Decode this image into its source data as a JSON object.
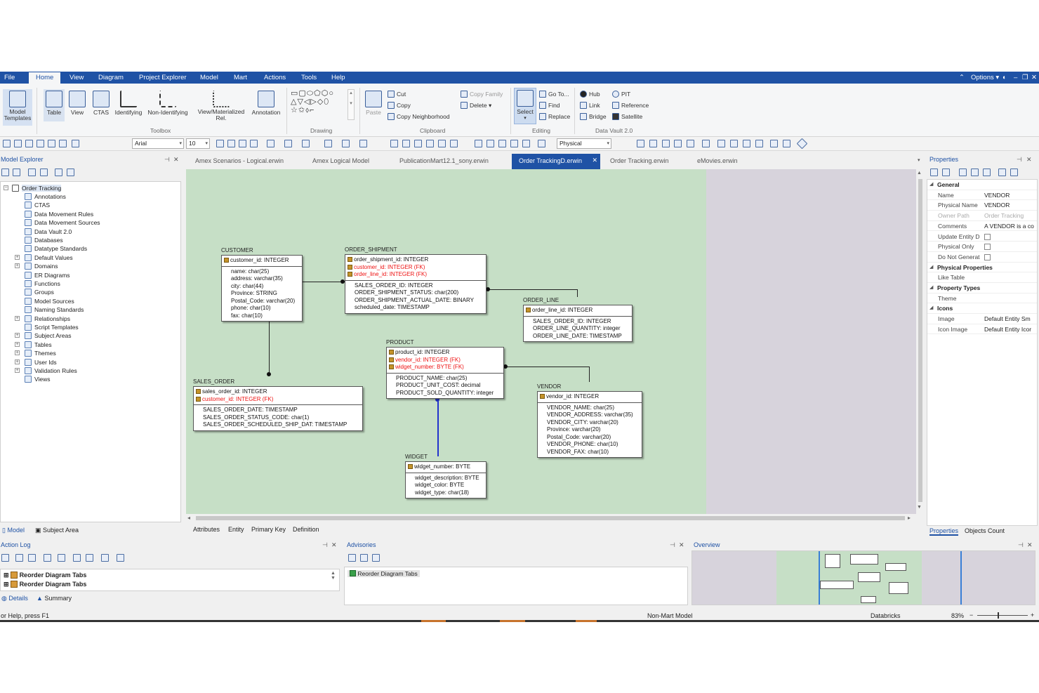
{
  "menu": {
    "items": [
      "File",
      "Home",
      "View",
      "Diagram",
      "Project Explorer",
      "Model",
      "Mart",
      "Actions",
      "Tools",
      "Help"
    ],
    "options": "Options"
  },
  "ribbon": {
    "model_templates": "Model Templates",
    "table": "Table",
    "view": "View",
    "ctas": "CTAS",
    "identifying": "Identifying",
    "non_identifying": "Non-Identifying",
    "view_materialized": "View/Materialized Rel.",
    "annotation": "Annotation",
    "toolbox_group": "Toolbox",
    "drawing_group": "Drawing",
    "paste": "Paste",
    "cut": "Cut",
    "copy": "Copy",
    "copy_neighborhood": "Copy Neighborhood",
    "copy_family": "Copy Family",
    "delete": "Delete",
    "clipboard_group": "Clipboard",
    "select": "Select",
    "go_to": "Go To...",
    "find": "Find",
    "replace": "Replace",
    "editing_group": "Editing",
    "hub": "Hub",
    "link": "Link",
    "bridge": "Bridge",
    "pit": "PIT",
    "reference": "Reference",
    "satellite": "Satellite",
    "datavault_group": "Data Vault 2.0"
  },
  "toolbar": {
    "font": "Arial",
    "size": "10",
    "notation": "Physical"
  },
  "explorer": {
    "title": "Model Explorer",
    "root": "Order Tracking",
    "items": [
      "Annotations",
      "CTAS",
      "Data Movement Rules",
      "Data Movement Sources",
      "Data Vault 2.0",
      "Databases",
      "Datatype Standards",
      "Default Values",
      "Domains",
      "ER Diagrams",
      "Functions",
      "Groups",
      "Model Sources",
      "Naming Standards",
      "Relationships",
      "Script Templates",
      "Subject Areas",
      "Tables",
      "Themes",
      "User Ids",
      "Validation Rules",
      "Views"
    ],
    "tab_model": "Model",
    "tab_subject": "Subject Area"
  },
  "doc_tabs": [
    "Amex Scenarios - Logical.erwin",
    "Amex Logical Model",
    "PublicationMart12.1_sony.erwin",
    "Order TrackingD.erwin",
    "Order Tracking.erwin",
    "eMovies.erwin"
  ],
  "entities": {
    "customer": {
      "name": "CUSTOMER",
      "pk": [
        "customer_id: INTEGER"
      ],
      "fk": [],
      "attrs": [
        "name: char(25)",
        "address: varchar(35)",
        "city: char(44)",
        "Province: STRING",
        "Postal_Code: varchar(20)",
        "phone: char(10)",
        "fax: char(10)"
      ]
    },
    "order_shipment": {
      "name": "ORDER_SHIPMENT",
      "pk": [
        "order_shipment_id: INTEGER"
      ],
      "fk": [
        "customer_id: INTEGER (FK)",
        "order_line_id: INTEGER (FK)"
      ],
      "attrs": [
        "SALES_ORDER_ID: INTEGER",
        "ORDER_SHIPMENT_STATUS: char(200)",
        "ORDER_SHIPMENT_ACTUAL_DATE: BINARY",
        "scheduled_date: TIMESTAMP"
      ]
    },
    "order_line": {
      "name": "ORDER_LINE",
      "pk": [
        "order_line_id: INTEGER"
      ],
      "fk": [],
      "attrs": [
        "SALES_ORDER_ID: INTEGER",
        "ORDER_LINE_QUANTITY: integer",
        "ORDER_LINE_DATE: TIMESTAMP"
      ]
    },
    "product": {
      "name": "PRODUCT",
      "pk": [
        "product_id: INTEGER"
      ],
      "fk": [
        "vendor_id: INTEGER (FK)",
        "widget_number: BYTE (FK)"
      ],
      "attrs": [
        "PRODUCT_NAME: char(25)",
        "PRODUCT_UNIT_COST: decimal",
        "PRODUCT_SOLD_QUANTITY: integer"
      ]
    },
    "sales_order": {
      "name": "SALES_ORDER",
      "pk": [
        "sales_order_id: INTEGER"
      ],
      "fk": [
        "customer_id: INTEGER (FK)"
      ],
      "attrs": [
        "SALES_ORDER_DATE: TIMESTAMP",
        "SALES_ORDER_STATUS_CODE: char(1)",
        "SALES_ORDER_SCHEDULED_SHIP_DAT: TIMESTAMP"
      ]
    },
    "vendor": {
      "name": "VENDOR",
      "pk": [
        "vendor_id: INTEGER"
      ],
      "fk": [],
      "attrs": [
        "VENDOR_NAME: char(25)",
        "VENDOR_ADDRESS: varchar(35)",
        "VENDOR_CITY: varchar(20)",
        "Province: varchar(20)",
        "Postal_Code: varchar(20)",
        "VENDOR_PHONE: char(10)",
        "VENDOR_FAX: char(10)"
      ]
    },
    "widget": {
      "name": "WIDGET",
      "pk": [
        "widget_number: BYTE"
      ],
      "fk": [],
      "attrs": [
        "widget_description: BYTE",
        "widget_color: BYTE",
        "widget_type: char(18)"
      ]
    }
  },
  "sheet_tabs": [
    "Attributes",
    "Entity",
    "Primary Key",
    "Definition"
  ],
  "properties": {
    "title": "Properties",
    "rows": [
      {
        "k": "General",
        "v": "",
        "type": "cat"
      },
      {
        "k": "Name",
        "v": "VENDOR",
        "type": "row"
      },
      {
        "k": "Physical Name",
        "v": "VENDOR",
        "type": "row"
      },
      {
        "k": "Owner Path",
        "v": "Order Tracking",
        "type": "dim"
      },
      {
        "k": "Comments",
        "v": "A VENDOR is a co",
        "type": "row"
      },
      {
        "k": "Update Entity D",
        "v": "",
        "type": "chk"
      },
      {
        "k": "Physical Only",
        "v": "",
        "type": "chk"
      },
      {
        "k": "Do Not Generat",
        "v": "",
        "type": "chk"
      },
      {
        "k": "Physical Properties",
        "v": "",
        "type": "cat"
      },
      {
        "k": "Like Table",
        "v": "",
        "type": "row"
      },
      {
        "k": "Property Types",
        "v": "",
        "type": "cat"
      },
      {
        "k": "Theme",
        "v": "",
        "type": "row"
      },
      {
        "k": "Icons",
        "v": "",
        "type": "cat"
      },
      {
        "k": "Image",
        "v": "Default Entity Sm",
        "type": "row"
      },
      {
        "k": "Icon Image",
        "v": "Default Entity Icor",
        "type": "row"
      }
    ],
    "tab_properties": "Properties",
    "tab_objects": "Objects Count"
  },
  "action_log": {
    "title": "Action Log",
    "entries": [
      "Reorder Diagram Tabs",
      "Reorder Diagram Tabs"
    ],
    "tab_details": "Details",
    "tab_summary": "Summary"
  },
  "advisories": {
    "title": "Advisories",
    "entries": [
      "Reorder Diagram Tabs"
    ]
  },
  "overview": {
    "title": "Overview"
  },
  "status": {
    "help": "or Help, press F1",
    "model": "Non-Mart Model",
    "db": "Databricks",
    "zoom": "83%"
  }
}
